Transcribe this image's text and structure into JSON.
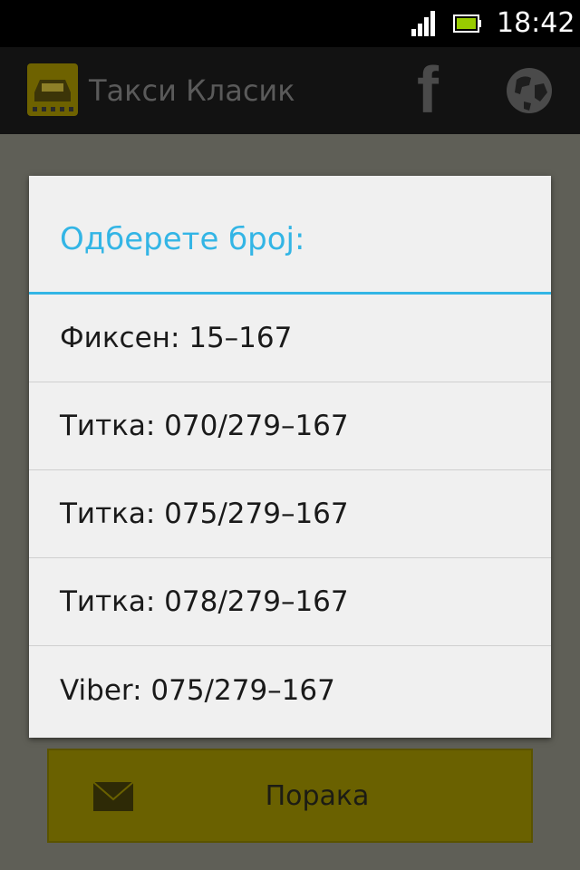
{
  "status_bar": {
    "time": "18:42"
  },
  "action_bar": {
    "title": "Такси Класик",
    "facebook_glyph": "f",
    "icons": [
      "taxi-app-icon",
      "facebook-icon",
      "globe-icon"
    ]
  },
  "dialog": {
    "title": "Одберете број:",
    "options": [
      "Фиксен: 15–167",
      "Титка: 070/279–167",
      "Титка: 075/279–167",
      "Титка: 078/279–167",
      "Viber: 075/279–167"
    ]
  },
  "content": {
    "message_button_label": "Порака"
  },
  "colors": {
    "accent": "#33b5e5",
    "dialog_bg": "#f0f0f0",
    "button_dimmed": "#6a6100"
  }
}
